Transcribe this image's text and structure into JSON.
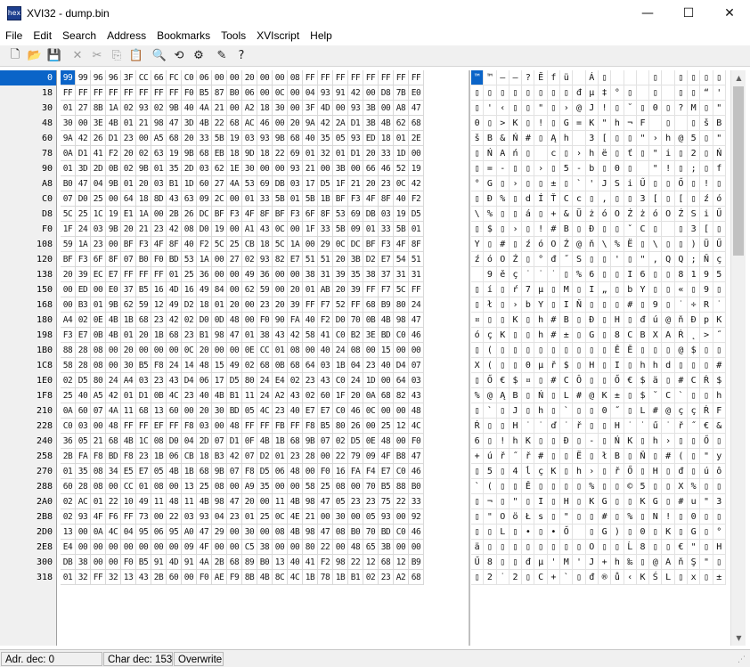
{
  "title": {
    "icon_text": "hex",
    "text": "XVI32 - dump.bin"
  },
  "window_buttons": {
    "minimize": "—",
    "maximize": "☐",
    "close": "✕"
  },
  "menu": [
    "File",
    "Edit",
    "Search",
    "Address",
    "Bookmarks",
    "Tools",
    "XVIscript",
    "Help"
  ],
  "toolbar": [
    {
      "name": "new-file-icon",
      "glyph": "🗋",
      "dim": false
    },
    {
      "name": "open-folder-icon",
      "glyph": "📂",
      "dim": false
    },
    {
      "name": "save-icon",
      "glyph": "💾",
      "dim": false
    },
    {
      "name": "close-x-icon",
      "glyph": "✕",
      "dim": true
    },
    {
      "name": "cut-icon",
      "glyph": "✂",
      "dim": true
    },
    {
      "name": "copy-icon",
      "glyph": "⎘",
      "dim": true
    },
    {
      "name": "paste-icon",
      "glyph": "📋",
      "dim": false
    },
    {
      "name": "find-icon",
      "glyph": "🔍",
      "dim": false
    },
    {
      "name": "replace-icon",
      "glyph": "⟲",
      "dim": false
    },
    {
      "name": "properties-icon",
      "glyph": "⚙",
      "dim": false
    },
    {
      "name": "script-icon",
      "glyph": "✎",
      "dim": false
    },
    {
      "name": "help-icon",
      "glyph": "?",
      "dim": false
    }
  ],
  "offsets": [
    "0",
    "18",
    "30",
    "48",
    "60",
    "78",
    "90",
    "A8",
    "C0",
    "D8",
    "F0",
    "108",
    "120",
    "138",
    "150",
    "168",
    "180",
    "198",
    "1B0",
    "1C8",
    "1E0",
    "1F8",
    "210",
    "228",
    "240",
    "258",
    "270",
    "288",
    "2A0",
    "2B8",
    "2D0",
    "2E8",
    "300",
    "318"
  ],
  "hex_rows": [
    "99 99 96 96 3F CC 66 FC C0 06 00 00 20 00 00 08 FF FF FF FF FF FF FF FF",
    "FF FF FF FF FF FF FF FF F0 B5 87 B0 06 00 0C 00 04 93 91 42 00 D8 7B E0",
    "01 27 8B 1A 02 93 02 9B 40 4A 21 00 A2 18 30 00 3F 4D 00 93 3B 00 A8 47",
    "30 00 3E 4B 01 21 98 47 3D 4B 22 68 AC 46 00 20 9A 42 2A D1 3B 4B 62 68",
    "9A 42 26 D1 23 00 A5 68 20 33 5B 19 03 93 9B 68 40 35 05 93 ED 18 01 2E",
    "0A D1 41 F2 20 02 63 19 9B 68 EB 18 9D 18 22 69 01 32 01 D1 20 33 1D 00",
    "01 3D 2D 0B 02 9B 01 35 2D 03 62 1E 30 00 00 93 21 00 3B 00 66 46 52 19",
    "B0 47 04 9B 01 20 03 B1 1D 60 27 4A 53 69 DB 03 17 D5 1F 21 20 23 0C 42",
    "07 D0 25 00 64 18 8D 43 63 09 2C 00 01 33 5B 01 5B 1B BF F3 4F 8F 40 F2",
    "5C 25 1C 19 E1 1A 00 2B 26 DC BF F3 4F 8F BF F3 6F 8F 53 69 DB 03 19 D5",
    "1F 24 03 9B 20 21 23 42 08 D0 19 00 A1 43 0C 00 1F 33 5B 09 01 33 5B 01",
    "59 1A 23 00 BF F3 4F 8F 40 F2 5C 25 CB 18 5C 1A 00 29 0C DC BF F3 4F 8F",
    "BF F3 6F 8F 07 B0 F0 BD 53 1A 00 27 02 93 82 E7 51 51 20 3B D2 E7 54 51",
    "20 39 EC E7 FF FF FF 01 25 36 00 00 49 36 00 00 38 31 39 35 38 37 31 31",
    "00 ED 00 E0 37 B5 16 4D 16 49 84 00 62 59 00 20 01 AB 20 39 FF F7 5C FF",
    "00 B3 01 9B 62 59 12 49 D2 18 01 20 00 23 20 39 FF F7 52 FF 68 B9 80 24",
    "A4 02 0E 4B 1B 68 23 42 02 D0 0D 48 00 F0 90 FA 40 F2 D0 70 0B 4B 98 47",
    "F3 E7 0B 4B 01 20 1B 68 23 B1 98 47 01 38 43 42 58 41 C0 B2 3E BD C0 46",
    "88 28 08 00 20 00 00 00 0C 20 00 00 0E CC 01 08 00 40 24 08 00 15 00 00",
    "58 28 08 00 30 B5 F8 24 14 48 15 49 02 68 0B 68 64 03 1B 04 23 40 D4 07",
    "02 D5 80 24 A4 03 23 43 D4 06 17 D5 80 24 E4 02 23 43 C0 24 1D 00 64 03",
    "25 40 A5 42 01 D1 0B 4C 23 40 4B B1 11 24 A2 43 02 60 1F 20 0A 68 82 43",
    "0A 60 07 4A 11 68 13 60 00 20 30 BD 05 4C 23 40 E7 E7 C0 46 0C 00 00 48",
    "C0 03 00 48 FF FF EF FF F8 03 00 48 FF FF FB FF F8 B5 80 26 00 25 12 4C",
    "36 05 21 68 4B 1C 08 D0 04 2D 07 D1 0F 4B 1B 68 9B 07 02 D5 0E 48 00 F0",
    "2B FA F8 BD F8 23 1B 06 CB 18 B3 42 07 D2 01 23 28 00 22 79 09 4F B8 47",
    "01 35 08 34 E5 E7 05 4B 1B 68 9B 07 F8 D5 06 48 00 F0 16 FA F4 E7 C0 46",
    "60 28 08 00 CC 01 08 00 13 25 08 00 A9 35 00 00 58 25 08 00 70 B5 88 B0",
    "02 AC 01 22 10 49 11 48 11 4B 98 47 20 00 11 4B 98 47 05 23 23 75 22 33",
    "02 93 4F F6 FF 73 00 22 03 93 04 23 01 25 0C 4E 21 00 30 00 05 93 00 92",
    "13 00 0A 4C 04 95 06 95 A0 47 29 00 30 00 08 4B 98 47 08 B0 70 BD C0 46",
    "E4 00 00 00 00 00 00 00 09 4F 00 00 C5 38 00 00 80 22 00 48 65 3B 00 00",
    "DB 38 00 00 F0 B5 91 4D 91 4A 2B 68 89 B0 13 40 41 F2 98 22 12 68 12 B9",
    "01 32 FF 32 13 43 2B 60 00 F0 AE F9 8B 4B 8C 4C 1B 78 1B B1 02 23 A2 68"
  ],
  "text_rows": [
    "™™––?Ĕfü Á▯   ▯ ▯▯▯▯▯▯▯▯",
    "▯▯▯▯▯▯▯▯đµ‡°▯ ▯ ▯▯“'B ŘÁ{ć",
    "▯'‹▯▯\"▯›@J!▯˘▯0▯?M▯\"▯;▯¨G",
    "0▯>K▯!▯G=K\"h¬F ▯ ▯šB*Ń;Kbh",
    "šB&Ń#▯Ąh 3[▯▯\"›h@5▯\"í▯▯.",
    "▯ŃAń▯ c▯›hë▯ť▯\"i▯2▯Ń 3▯",
    "▯=-▯▯›▯5-b▯0▯ \"!▯;▯fFR▯",
    "°G▯›▯▯±▯`'JSiŰ▯▯Ő▯!▯#ÓB",
    "▯Đ%▯dÍŤCc▯,▯▯3[▯[▯źóOŹ@ň",
    "\\%▯▯á▯+&ÜżóOŹżóOŹSiŰ▯▯Ő",
    "▯$▯›▯!#B▯Đ▯▯ˇC▯ ▯3[▯▯3[▯",
    "Y▯#▯źóOŹ@ň\\%Ë▯\\▯▯)ÜŰźóOŹ",
    "źóOŹ▯°đ˝S▯▯'▯\",QQ;ŇçTQ",
    " 9ěç˙˙˙▯%6▯▯I6▯▯8195871 1",
    "▯í▯ŕ7µ▯M▯I„▯bY▯▯«▯9▯˙÷\\˙",
    "▯ł▯›bY▯IŇ▯▯▯#▯9▯˙÷R˙hąĘ$",
    "¤▯▯K▯h#B▯Đ▯H▯đú@ňĐpK▯G",
    "óçK▯▯h#±▯G▯8CBXAŔ˛>˝ŔF",
    "▯(▯▯▯▯▯▯▯▯▯ĚĚ▯▯▯@$▯▯▯▯",
    "X(▯▯0µř$▯H▯I▯hhd▯▯▯#@ÔŐ",
    "▯Ő€$¤▯#CÔ▯▯Ő€$ä▯#CŔ$▯▯d▯",
    "%@ĄB▯Ń▯L#@K±▯$˘C`▯▯h‚C",
    "▯`▯J▯h▯`▯▯0˝▯L#@ççŔF▯▯▯H",
    "Ŕ▯▯H˙˙ď˙ř▯▯H˙˙ű˙ř˝€&▯%▯L",
    "6▯!hK▯▯Đ▯-▯ŃK▯h›▯▯Ő▯H▯đ",
    "+úř˝ř#▯▯Ë▯łB▯Ň▯#(▯\"y▯Oë G",
    "▯5▯4ĺçK▯h›▯řŐ▯H▯đ▯úôçŔF",
    "`(▯▯Ě▯▯▯▯%▯▯©5▯▯X%▯▯pµ°",
    "▯¬▯\"▯I▯H▯KG▯▯KG▯#u\"3",
    "▯\"OöŁs▯\"▯▯#▯%▯N!▯0▯▯\"▯'",
    "▯▯L▯•▯•Ő ▯G)▯0▯K▯G▯°p˝ŔF",
    "ä▯▯▯▯▯▯▯▯O▯▯Ĺ8▯▯€\"▯He;▯▯",
    "Ű8▯▯đµ'M'J+h‰▯@AňŞ\"▯h▯ą",
    "▯2˙2▯C+`▯đ®ů‹KŚL▯x▯±▯#˘h"
  ],
  "status": {
    "address": "Adr. dec: 0",
    "char": "Char dec: 153",
    "mode": "Overwrite"
  }
}
